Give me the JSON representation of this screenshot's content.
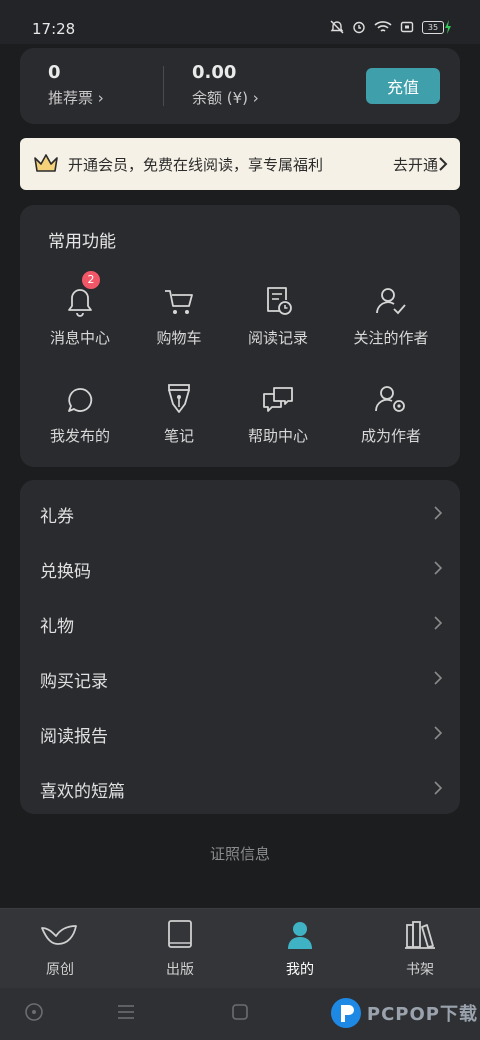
{
  "status_bar": {
    "time": "17:28",
    "battery": "35"
  },
  "balance": {
    "tickets_value": "0",
    "tickets_label": "推荐票 ›",
    "balance_value": "0.00",
    "balance_label": "余额 (¥) ›",
    "recharge_label": "充值"
  },
  "vip_banner": {
    "text": "开通会员，免费在线阅读，享专属福利",
    "link": "去开通"
  },
  "functions": {
    "title": "常用功能",
    "items": [
      {
        "label": "消息中心",
        "icon": "bell-icon",
        "badge": "2"
      },
      {
        "label": "购物车",
        "icon": "cart-icon"
      },
      {
        "label": "阅读记录",
        "icon": "reading-history-icon"
      },
      {
        "label": "关注的作者",
        "icon": "followed-author-icon"
      },
      {
        "label": "我发布的",
        "icon": "chat-bubble-icon"
      },
      {
        "label": "笔记",
        "icon": "pen-nib-icon"
      },
      {
        "label": "帮助中心",
        "icon": "help-chat-icon"
      },
      {
        "label": "成为作者",
        "icon": "author-settings-icon"
      }
    ]
  },
  "menu": {
    "items": [
      {
        "label": "礼券"
      },
      {
        "label": "兑换码"
      },
      {
        "label": "礼物"
      },
      {
        "label": "购买记录"
      },
      {
        "label": "阅读报告"
      },
      {
        "label": "喜欢的短篇"
      }
    ]
  },
  "license_label": "证照信息",
  "tabs": [
    {
      "label": "原创",
      "icon": "bird-icon"
    },
    {
      "label": "出版",
      "icon": "book-icon"
    },
    {
      "label": "我的",
      "icon": "user-icon",
      "active": true
    },
    {
      "label": "书架",
      "icon": "bookshelf-icon"
    }
  ],
  "watermark": {
    "text": "PCPOP下载"
  },
  "colors": {
    "accent": "#3f9fab",
    "badge": "#f25767",
    "banner_bg": "#f6f1e6",
    "crown": "#e0a63a"
  }
}
